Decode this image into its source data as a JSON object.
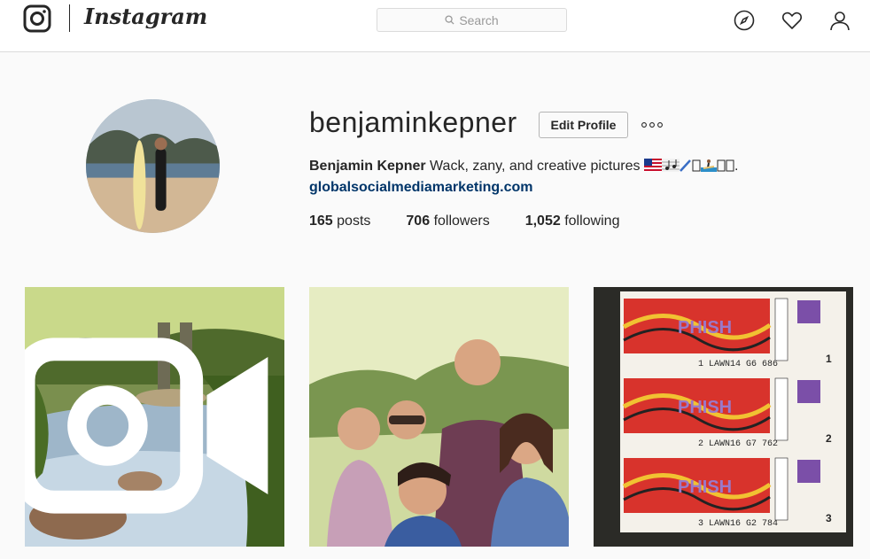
{
  "header": {
    "wordmark": "Instagram",
    "search_placeholder": "Search",
    "icons": [
      "instagram-logo-icon",
      "search-icon",
      "explore-compass-icon",
      "heart-icon",
      "profile-icon"
    ]
  },
  "profile": {
    "username": "benjaminkepner",
    "edit_button": "Edit Profile",
    "full_name": "Benjamin Kepner",
    "bio_text": "Wack, zany, and creative pictures",
    "bio_end": ".",
    "website": "globalsocialmediamarketing.com",
    "stats": {
      "posts_count": "165",
      "posts_label": "posts",
      "followers_count": "706",
      "followers_label": "followers",
      "following_count": "1,052",
      "following_label": "following"
    }
  },
  "posts": [
    {
      "label": "river-video-post",
      "is_video": true
    },
    {
      "label": "friends-group-photo-post",
      "is_video": false
    },
    {
      "label": "concert-tickets-post",
      "is_video": false
    }
  ],
  "tickets": {
    "band": "PHISH",
    "rows": [
      {
        "section": "LAWN14 G6",
        "seat": "686",
        "number": "1"
      },
      {
        "section": "LAWN16 G7",
        "seat": "762",
        "number": "2"
      },
      {
        "section": "LAWN16 G2",
        "seat": "784",
        "number": "3"
      }
    ]
  },
  "colors": {
    "link": "#003569",
    "border": "#dbdbdb",
    "background": "#fafafa"
  }
}
